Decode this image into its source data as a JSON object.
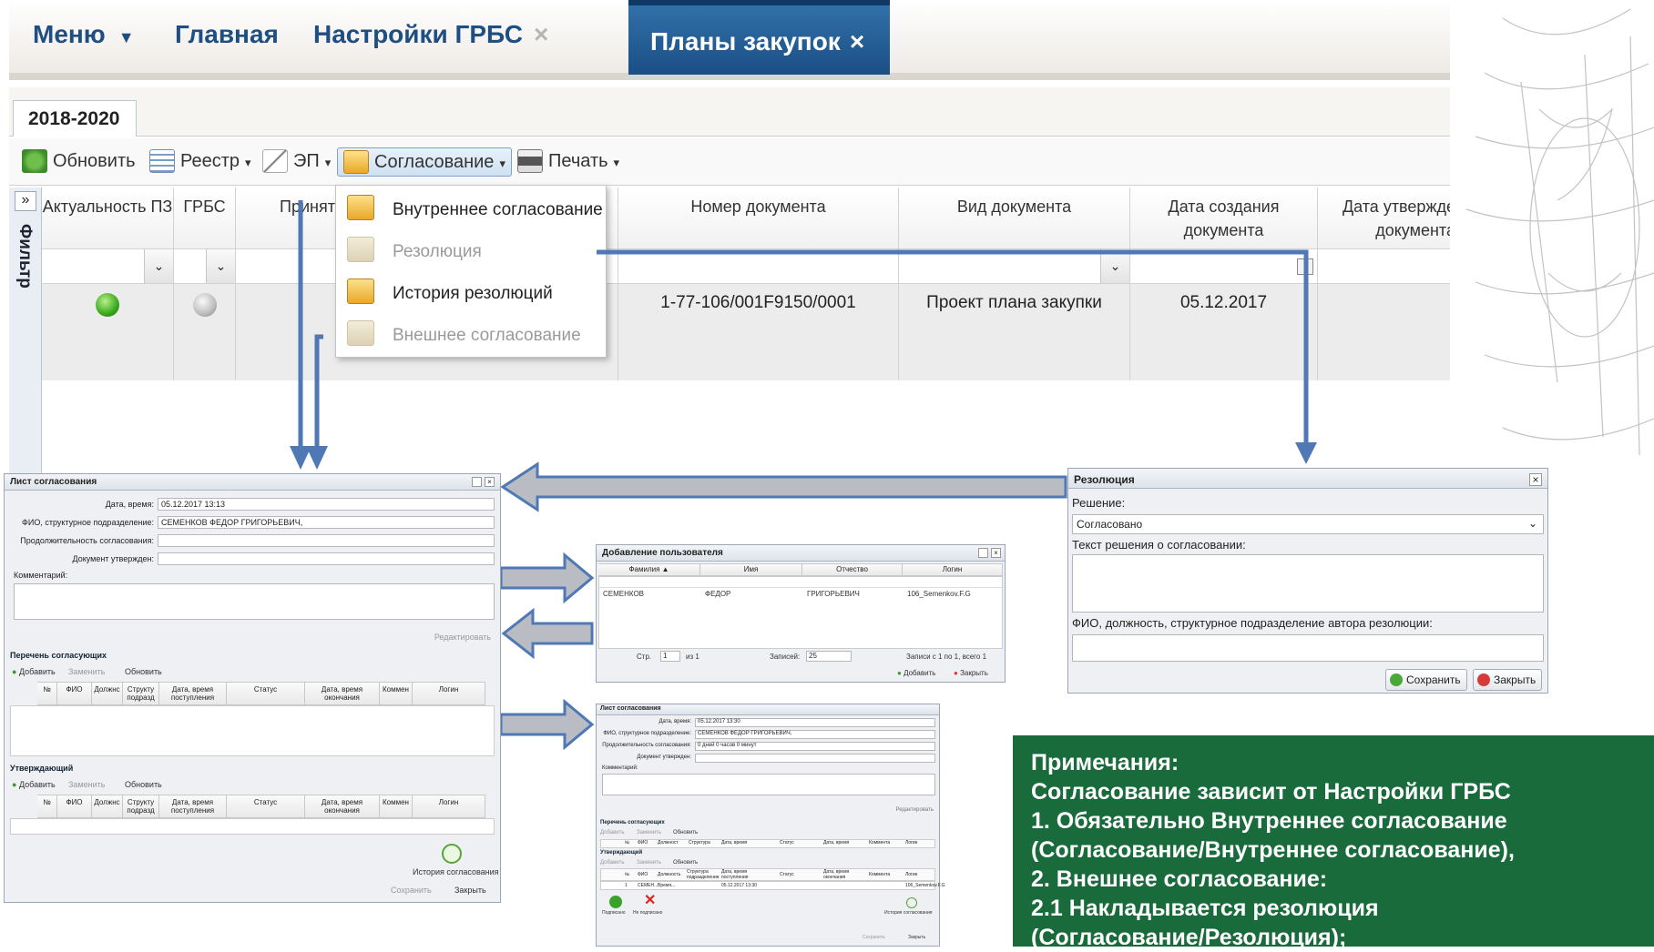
{
  "tabs": {
    "menu": "Меню",
    "home": "Главная",
    "grbs_settings": "Настройки ГРБС",
    "plans": "Планы закупок",
    "close_glyph": "×",
    "menu_caret": "▼"
  },
  "year_tab": "2018-2020",
  "toolbar": {
    "refresh": "Обновить",
    "registry": "Реестр",
    "ep": "ЭП",
    "approval": "Согласование",
    "print": "Печать",
    "caret": "▾"
  },
  "filter_label": "Фильтр",
  "filter_toggle": "»",
  "grid": {
    "headers": [
      "Актуальность ПЗ",
      "ГРБС",
      "Приняты",
      "Номер документа",
      "Вид документа",
      "Дата создания документа",
      "Дата утвержде документа"
    ],
    "row": {
      "number": "1-77-106/001F9150/0001",
      "type": "Проект плана закупки",
      "created": "05.12.2017"
    },
    "dropdown_glyph": "⌄"
  },
  "approval_menu": {
    "items": [
      "Внутреннее согласование",
      "Резолюция",
      "История резолюций",
      "Внешнее согласование"
    ]
  },
  "approval_sheet": {
    "title": "Лист согласования",
    "date_label": "Дата, время:",
    "date_value": "05.12.2017 13:13",
    "fio_label": "ФИО, структурное подразделение:",
    "fio_value": "СЕМЕНКОВ ФЕДОР ГРИГОРЬЕВИЧ,",
    "duration_label": "Продолжительность согласования:",
    "approved_label": "Документ утвержден:",
    "comment_label": "Комментарий:",
    "edit": "Редактировать",
    "approvers_title": "Перечень согласующих",
    "add": "Добавить",
    "replace": "Заменить",
    "refresh": "Обновить",
    "columns": [
      "№",
      "ФИО",
      "Должнс",
      "Структу подразд",
      "Дата, время поступления",
      "Статус",
      "Дата, время окончания",
      "Коммен",
      "Логин"
    ],
    "approver_title": "Утверждающий",
    "history": "История согласования",
    "save": "Сохранить",
    "close": "Закрыть"
  },
  "add_user": {
    "title": "Добавление пользователя",
    "columns": [
      "Фамилия ▲",
      "Имя",
      "Отчество",
      "Логин"
    ],
    "row": [
      "СЕМЕНКОВ",
      "ФЕДОР",
      "ГРИГОРЬЕВИЧ",
      "106_Semenkov.F.G"
    ],
    "page_label": "Стр.",
    "page": "1",
    "of": "из 1",
    "records_label": "Записей:",
    "records": "25",
    "summary": "Записи с 1 по 1, всего 1",
    "add": "Добавить",
    "close": "Закрыть"
  },
  "sheet2": {
    "title": "Лист согласования",
    "date_label": "Дата, время:",
    "date_value": "05.12.2017 13:30",
    "fio_label": "ФИО, структурное подразделение:",
    "fio_value": "СЕМЕНКОВ ФЕДОР ГРИГОРЬЕВИЧ,",
    "duration_label": "Продолжительность согласования:",
    "duration_value": "0 дней 0 часов 0 минут",
    "approved_label": "Документ утвержден:",
    "comment_label": "Комментарий:",
    "edit": "Редактировать",
    "approvers_title": "Перечень согласующих",
    "add": "Добавить",
    "replace": "Заменить",
    "refresh": "Обновить",
    "columns": [
      "№",
      "ФИО",
      "Должност",
      "Структура",
      "Дата, время",
      "Статус",
      "Дата, время",
      "Коммента",
      "Логин"
    ],
    "approver_title": "Утверждающий",
    "columns2": [
      "№",
      "ФИО",
      "Должность",
      "Структура подразделение",
      "Дата, время поступления",
      "Статус",
      "Дата, время окончания",
      "Коммента",
      "Логин"
    ],
    "row": [
      "1",
      "СЕМЕН...",
      "Время...",
      "05.12.2017 13:30",
      "106_Semenkov.F.G"
    ],
    "signed": "Подписано",
    "not_signed": "Не подписано",
    "history": "История согласования",
    "save": "Сохранить",
    "close": "Закрыть"
  },
  "resolution": {
    "title": "Резолюция",
    "decision_label": "Решение:",
    "decision_value": "Согласовано",
    "text_label": "Текст решения о согласовании:",
    "author_label": "ФИО, должность, структурное подразделение автора резолюции:",
    "save": "Сохранить",
    "close": "Закрыть"
  },
  "notes": {
    "lines": [
      "Примечания:",
      "Согласование зависит от Настройки ГРБС",
      "1. Обязательно Внутреннее согласование",
      "(Согласование/Внутреннее согласование),",
      "2. Внешнее согласование:",
      "2.1 Накладывается резолюция",
      "(Согласование/Резолюция);"
    ]
  },
  "colors": {
    "brand_blue": "#1f4f82",
    "active_tab": "#1a4f85",
    "note_green": "#1a6b3c",
    "arrow_blue": "#4f78b5"
  }
}
